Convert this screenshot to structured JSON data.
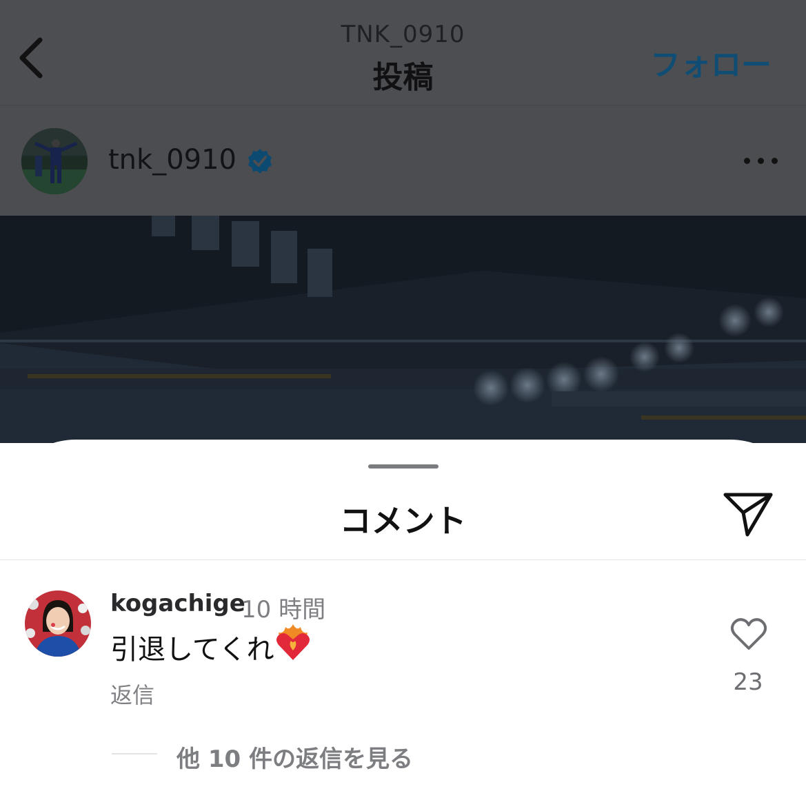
{
  "header": {
    "username": "TNK_0910",
    "title": "投稿",
    "follow_label": "フォロー"
  },
  "post": {
    "author": "tnk_0910",
    "verified": true
  },
  "comments_sheet": {
    "title": "コメント",
    "comment": {
      "username": "kogachige",
      "time": "10 時間",
      "text": "引退してくれ",
      "emoji": "heart-on-fire",
      "reply_label": "返信",
      "like_count": "23",
      "view_replies_label": "他 10 件の返信を見る"
    }
  },
  "colors": {
    "follow": "#0f4d74",
    "verified": "#0c4a72",
    "overlay": "#4d4e52"
  }
}
